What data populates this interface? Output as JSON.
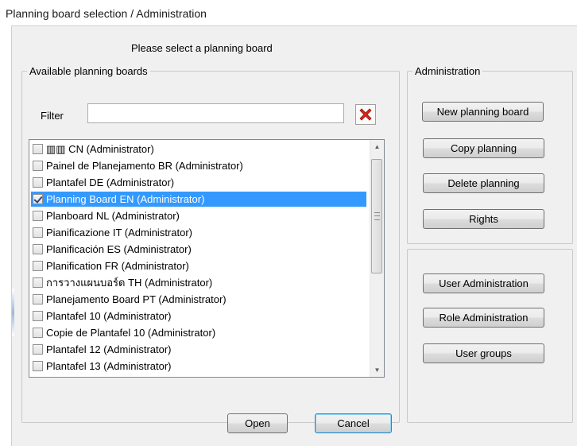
{
  "window": {
    "title": "Planning board selection / Administration"
  },
  "prompt": "Please select a planning board",
  "boards_group": {
    "legend": "Available planning boards",
    "filter_label": "Filter",
    "filter_value": "",
    "items": [
      {
        "label": "▥▥ CN (Administrator)",
        "checked": false,
        "selected": false
      },
      {
        "label": "Painel de Planejamento BR (Administrator)",
        "checked": false,
        "selected": false
      },
      {
        "label": "Plantafel DE (Administrator)",
        "checked": false,
        "selected": false
      },
      {
        "label": "Planning Board EN (Administrator)",
        "checked": true,
        "selected": true
      },
      {
        "label": "Planboard NL (Administrator)",
        "checked": false,
        "selected": false
      },
      {
        "label": "Pianificazione IT (Administrator)",
        "checked": false,
        "selected": false
      },
      {
        "label": "Planificación ES (Administrator)",
        "checked": false,
        "selected": false
      },
      {
        "label": "Planification FR (Administrator)",
        "checked": false,
        "selected": false
      },
      {
        "label": "การวางแผนบอร์ด TH (Administrator)",
        "checked": false,
        "selected": false
      },
      {
        "label": "Planejamento Board PT (Administrator)",
        "checked": false,
        "selected": false
      },
      {
        "label": "Plantafel 10 (Administrator)",
        "checked": false,
        "selected": false
      },
      {
        "label": "Copie de Plantafel 10 (Administrator)",
        "checked": false,
        "selected": false
      },
      {
        "label": "Plantafel 12 (Administrator)",
        "checked": false,
        "selected": false
      },
      {
        "label": "Plantafel 13 (Administrator)",
        "checked": false,
        "selected": false
      }
    ]
  },
  "admin_group": {
    "legend": "Administration",
    "new_planning_board": "New planning board",
    "copy_planning": "Copy planning",
    "delete_planning": "Delete planning",
    "rights": "Rights"
  },
  "user_group": {
    "user_administration": "User Administration",
    "role_administration": "Role Administration",
    "user_groups": "User groups"
  },
  "footer": {
    "open": "Open",
    "cancel": "Cancel"
  },
  "colors": {
    "selection": "#3399ff",
    "clear_icon": "#d9261c"
  }
}
